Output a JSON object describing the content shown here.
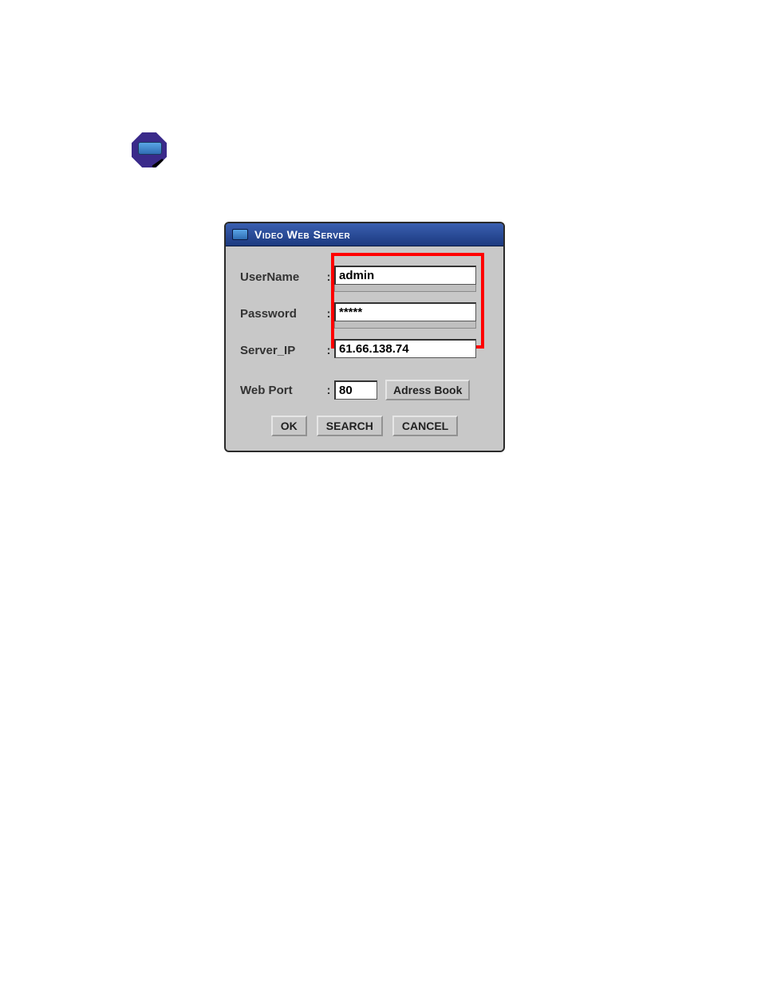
{
  "icon": {
    "name": "video-web-server-app-icon"
  },
  "dialog": {
    "title": "Video Web Server",
    "fields": {
      "username": {
        "label": "UserName",
        "value": "admin"
      },
      "password": {
        "label": "Password",
        "value": "*****"
      },
      "server_ip": {
        "label": "Server_IP",
        "value": "61.66.138.74"
      },
      "web_port": {
        "label": "Web Port",
        "value": "80"
      }
    },
    "buttons": {
      "address_book": "Adress Book",
      "ok": "OK",
      "search": "SEARCH",
      "cancel": "CANCEL"
    }
  }
}
